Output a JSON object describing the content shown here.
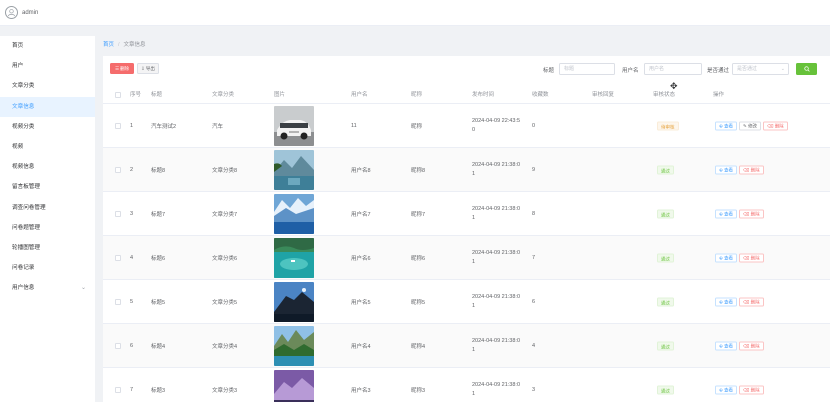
{
  "header": {
    "username": "admin"
  },
  "sidebar": {
    "items": [
      {
        "label": "首页"
      },
      {
        "label": "用户"
      },
      {
        "label": "文章分类"
      },
      {
        "label": "文章信息"
      },
      {
        "label": "视频分类"
      },
      {
        "label": "视频"
      },
      {
        "label": "视频信息"
      },
      {
        "label": "留言板管理"
      },
      {
        "label": "调查问卷管理"
      },
      {
        "label": "问卷题管理"
      },
      {
        "label": "轮播图管理"
      },
      {
        "label": "问卷记录"
      },
      {
        "label": "用户信息"
      }
    ],
    "active_index": 3
  },
  "breadcrumb": {
    "home": "首页",
    "separator": "/",
    "current": "文章信息"
  },
  "toolbar": {
    "delete_label": "删除",
    "export_label": "导出"
  },
  "filters": {
    "title_label": "标题",
    "title_placeholder": "标题",
    "user_label": "用户名",
    "user_placeholder": "用户名",
    "review_label": "是否通过",
    "review_placeholder": "是否通过"
  },
  "table": {
    "headers": [
      "序号",
      "标题",
      "文章分类",
      "图片",
      "用户名",
      "昵称",
      "发布时间",
      "收藏数",
      "审核回复",
      "审核状态",
      "操作"
    ],
    "rows": [
      {
        "index": "1",
        "title": "汽车测试2",
        "category": "汽车",
        "username": "11",
        "nickname": "昵称",
        "time_line1": "2024-04-09 22:43:5",
        "time_line2": "0",
        "favorites": "0",
        "reply": "",
        "status": "待审核",
        "status_type": "pending",
        "image": "car",
        "edit": true
      },
      {
        "index": "2",
        "title": "标题8",
        "category": "文章分类8",
        "username": "用户名8",
        "nickname": "昵称8",
        "time_line1": "2024-04-09 21:38:0",
        "time_line2": "1",
        "favorites": "9",
        "reply": "",
        "status": "通过",
        "status_type": "pass",
        "image": "lake-mountain",
        "edit": false
      },
      {
        "index": "3",
        "title": "标题7",
        "category": "文章分类7",
        "username": "用户名7",
        "nickname": "昵称7",
        "time_line1": "2024-04-09 21:38:0",
        "time_line2": "1",
        "favorites": "8",
        "reply": "",
        "status": "通过",
        "status_type": "pass",
        "image": "glacier",
        "edit": false
      },
      {
        "index": "4",
        "title": "标题6",
        "category": "文章分类6",
        "username": "用户名6",
        "nickname": "昵称6",
        "time_line1": "2024-04-09 21:38:0",
        "time_line2": "1",
        "favorites": "7",
        "reply": "",
        "status": "通过",
        "status_type": "pass",
        "image": "lagoon",
        "edit": false
      },
      {
        "index": "5",
        "title": "标题5",
        "category": "文章分类5",
        "username": "用户名5",
        "nickname": "昵称5",
        "time_line1": "2024-04-09 21:38:0",
        "time_line2": "1",
        "favorites": "6",
        "reply": "",
        "status": "通过",
        "status_type": "pass",
        "image": "cliff",
        "edit": false
      },
      {
        "index": "6",
        "title": "标题4",
        "category": "文章分类4",
        "username": "用户名4",
        "nickname": "昵称4",
        "time_line1": "2024-04-09 21:38:0",
        "time_line2": "1",
        "favorites": "4",
        "reply": "",
        "status": "通过",
        "status_type": "pass",
        "image": "valley",
        "edit": false
      },
      {
        "index": "7",
        "title": "标题3",
        "category": "文章分类3",
        "username": "用户名3",
        "nickname": "昵称3",
        "time_line1": "2024-04-09 21:38:0",
        "time_line2": "1",
        "favorites": "3",
        "reply": "",
        "status": "通过",
        "status_type": "pass",
        "image": "purple-mountain",
        "edit": false
      }
    ],
    "op_view": "查看",
    "op_edit": "修改",
    "op_delete": "删除"
  }
}
